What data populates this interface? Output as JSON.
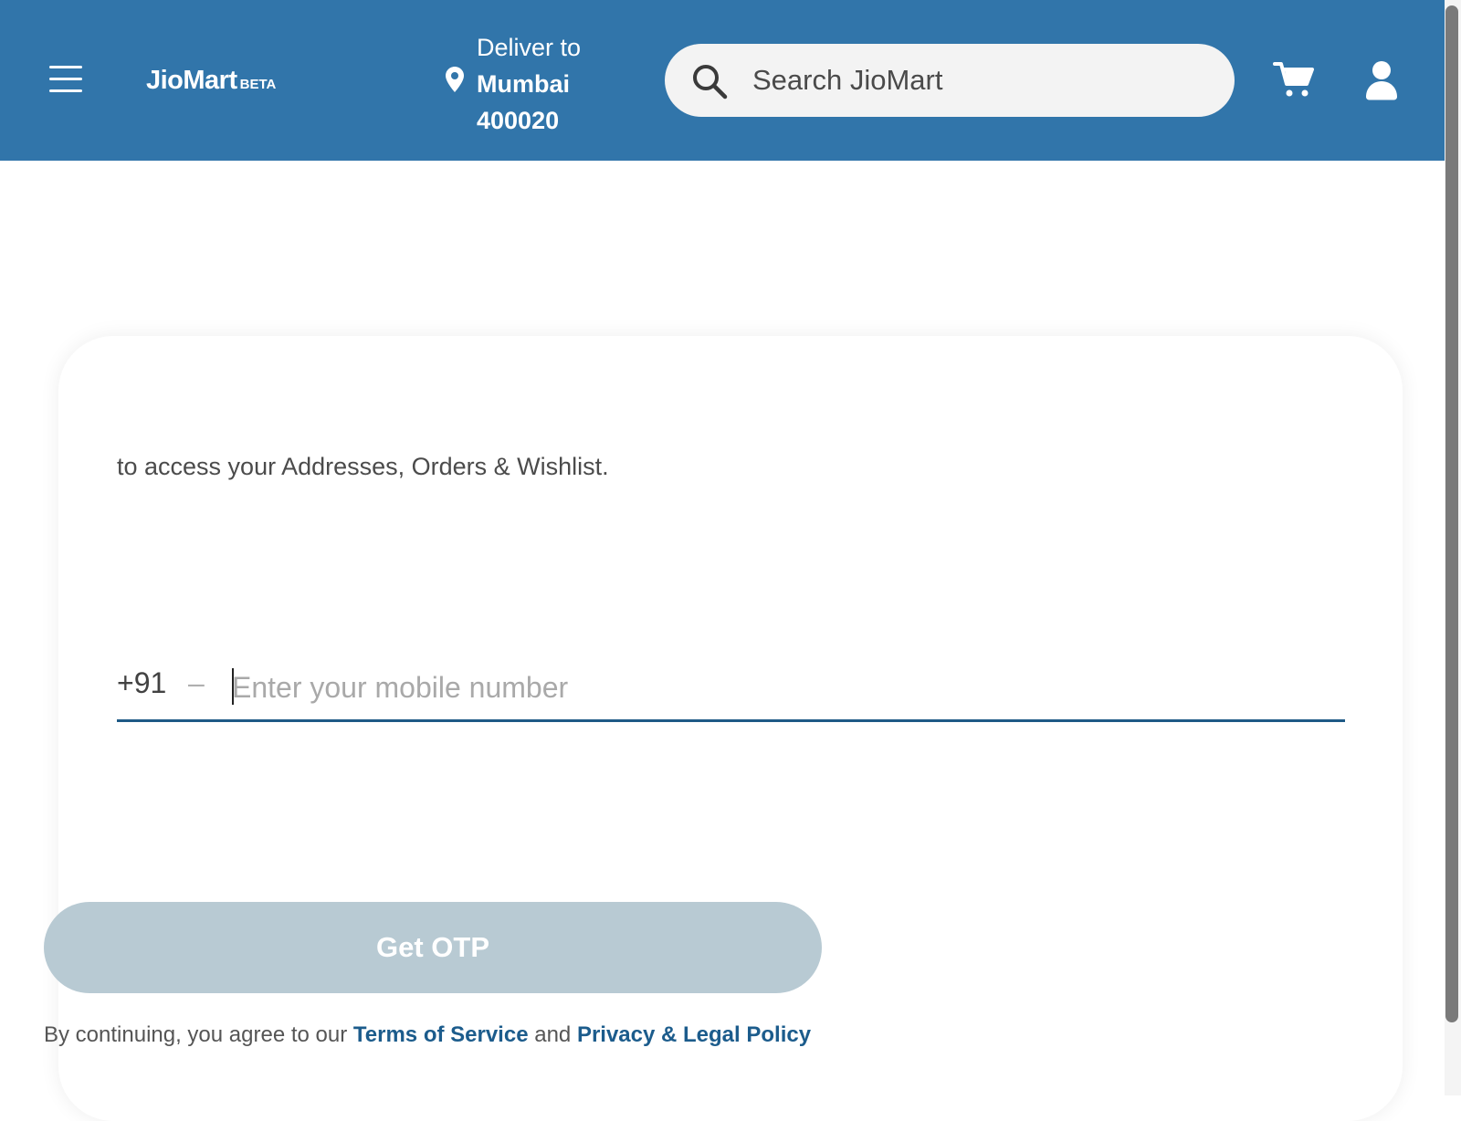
{
  "colors": {
    "header_bg": "#3175aa",
    "search_bg": "#f3f3f3",
    "button_disabled_bg": "#b8cad3",
    "link": "#1c5c8c",
    "input_underline": "#1e5a86"
  },
  "header": {
    "menu_icon": "hamburger-menu-icon",
    "logo": {
      "brand": "JioMart",
      "tag": "BETA"
    },
    "location": {
      "icon": "location-pin-icon",
      "label": "Deliver to",
      "city": "Mumbai",
      "pincode": "400020"
    },
    "search": {
      "icon": "search-icon",
      "placeholder": "Search JioMart"
    },
    "cart_icon": "cart-icon",
    "account_icon": "user-icon"
  },
  "login": {
    "subtitle": "to access your Addresses, Orders & Wishlist.",
    "country_code": "+91",
    "separator": "–",
    "phone_placeholder": "Enter your mobile number",
    "phone_value": "",
    "otp_button": "Get OTP",
    "terms": {
      "prefix": "By continuing, you agree to our ",
      "tos": "Terms of Service",
      "and": " and ",
      "privacy": "Privacy & Legal Policy"
    }
  }
}
